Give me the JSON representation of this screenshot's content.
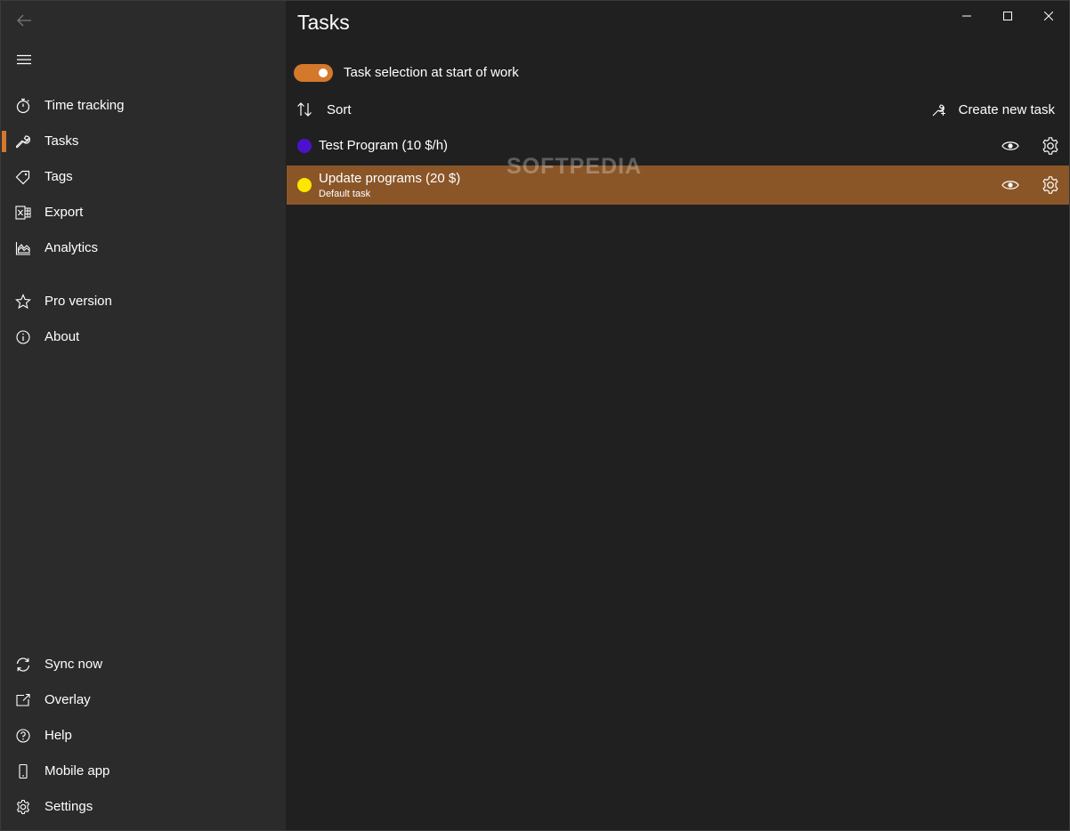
{
  "sidebar": {
    "back_icon": "back-arrow-icon",
    "menu_icon": "hamburger-menu-icon",
    "top_items": [
      {
        "label": "Time tracking",
        "icon": "stopwatch-icon"
      },
      {
        "label": "Tasks",
        "icon": "wrench-icon",
        "selected": true
      },
      {
        "label": "Tags",
        "icon": "tag-icon"
      },
      {
        "label": "Export",
        "icon": "excel-icon"
      },
      {
        "label": "Analytics",
        "icon": "area-chart-icon"
      },
      {
        "label": "Pro version",
        "icon": "star-icon"
      },
      {
        "label": "About",
        "icon": "info-icon"
      }
    ],
    "bottom_items": [
      {
        "label": "Sync now",
        "icon": "sync-icon"
      },
      {
        "label": "Overlay",
        "icon": "overlay-icon"
      },
      {
        "label": "Help",
        "icon": "help-icon"
      },
      {
        "label": "Mobile app",
        "icon": "phone-icon"
      },
      {
        "label": "Settings",
        "icon": "gear-icon"
      }
    ]
  },
  "main": {
    "title": "Tasks",
    "toggle": {
      "label": "Task selection at start of work",
      "on": true
    },
    "sort_label": "Sort",
    "create_label": "Create new task",
    "tasks": [
      {
        "name": "Test Program (10 $/h)",
        "subtitle": "",
        "color": "#4b12cc",
        "selected": false
      },
      {
        "name": "Update programs (20 $)",
        "subtitle": "Default task",
        "color": "#ffe600",
        "selected": true
      }
    ]
  },
  "watermark": "SOFTPEDIA",
  "colors": {
    "accent": "#d4782c",
    "selected_row": "#8a5628",
    "sidebar_bg": "#2b2b2b",
    "main_bg": "#202020"
  }
}
